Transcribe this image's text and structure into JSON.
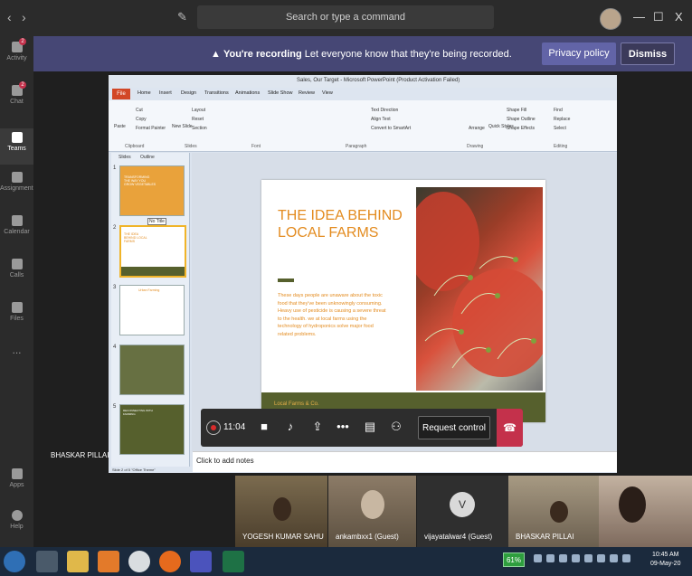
{
  "titlebar": {
    "search_placeholder": "Search or type a command",
    "nav_back": "‹",
    "nav_forward": "›",
    "minimize": "—",
    "maximize": "☐",
    "close": "X"
  },
  "rail": {
    "items": [
      {
        "label": "Activity",
        "badge": "2"
      },
      {
        "label": "Chat",
        "badge": "2"
      },
      {
        "label": "Teams",
        "badge": ""
      },
      {
        "label": "Assignments",
        "badge": ""
      },
      {
        "label": "Calendar",
        "badge": ""
      },
      {
        "label": "Calls",
        "badge": ""
      },
      {
        "label": "Files",
        "badge": ""
      },
      {
        "label": "...",
        "badge": ""
      },
      {
        "label": "Apps",
        "badge": ""
      },
      {
        "label": "Help",
        "badge": ""
      }
    ]
  },
  "banner": {
    "title": "You're recording",
    "message": "Let everyone know that they're being recorded.",
    "privacy_label": "Privacy policy",
    "dismiss_label": "Dismiss"
  },
  "presenter": {
    "name": "BHASKAR PILLAI"
  },
  "powerpoint": {
    "window_title": "Sales, Our Target - Microsoft PowerPoint (Product Activation Failed)",
    "file_tab": "File",
    "tabs": [
      "Home",
      "Insert",
      "Design",
      "Transitions",
      "Animations",
      "Slide Show",
      "Review",
      "View"
    ],
    "ribbon_groups": [
      "Clipboard",
      "Slides",
      "Font",
      "Paragraph",
      "Drawing",
      "Editing"
    ],
    "ribbon_items": {
      "cut": "Cut",
      "copy": "Copy",
      "paste": "Paste",
      "format_painter": "Format Painter",
      "new_slide": "New Slide",
      "layout": "Layout",
      "reset": "Reset",
      "section": "Section",
      "text_direction": "Text Direction",
      "align_text": "Align Text",
      "convert_smartart": "Convert to SmartArt",
      "arrange": "Arrange",
      "quick_styles": "Quick Styles",
      "shape_fill": "Shape Fill",
      "shape_outline": "Shape Outline",
      "shape_effects": "Shape Effects",
      "find": "Find",
      "replace": "Replace",
      "select": "Select"
    },
    "pane_tabs": [
      "Slides",
      "Outline"
    ],
    "thumb_tooltip": "No Title",
    "thumbnails": [
      {
        "number": "1",
        "text": "TRANSFORMING THE WAY YOU GROW VEGETABLES"
      },
      {
        "number": "2",
        "text": "THE IDEA BEHIND LOCAL FARMS"
      },
      {
        "number": "3",
        "text": "Urban Farming"
      },
      {
        "number": "4",
        "text": ""
      },
      {
        "number": "5",
        "text": "RECONNECTING WITH FARMING"
      }
    ],
    "slide": {
      "title": "THE IDEA BEHIND LOCAL FARMS",
      "body": "These days people are unaware about the toxic food that they've been unknowingly consuming. Heavy use of pesticide is causing a severe threat to the health. we at local farms using the technology of hydroponics solve major food related problems.",
      "footer": "Local Farms & Co."
    },
    "notes_placeholder": "Click to add notes",
    "status_text": "Slide 2 of 5    \"Office Theme\""
  },
  "call_controls": {
    "timer": "11:04",
    "request_control_label": "Request control"
  },
  "participants": [
    {
      "name": "YOGESH KUMAR SAHU"
    },
    {
      "name": "ankambxx1 (Guest)"
    },
    {
      "name": "vijayatalwar4 (Guest)",
      "initial": "V"
    },
    {
      "name": "BHASKAR PILLAI"
    },
    {
      "name": ""
    }
  ],
  "taskbar": {
    "battery": "61%",
    "time": "10:45 AM",
    "date": "09-May-20"
  },
  "colors": {
    "banner": "#464775",
    "accent": "#6264a7",
    "hangup": "#c4314b",
    "slide_orange": "#e38b1f",
    "slide_olive": "#56602d"
  }
}
